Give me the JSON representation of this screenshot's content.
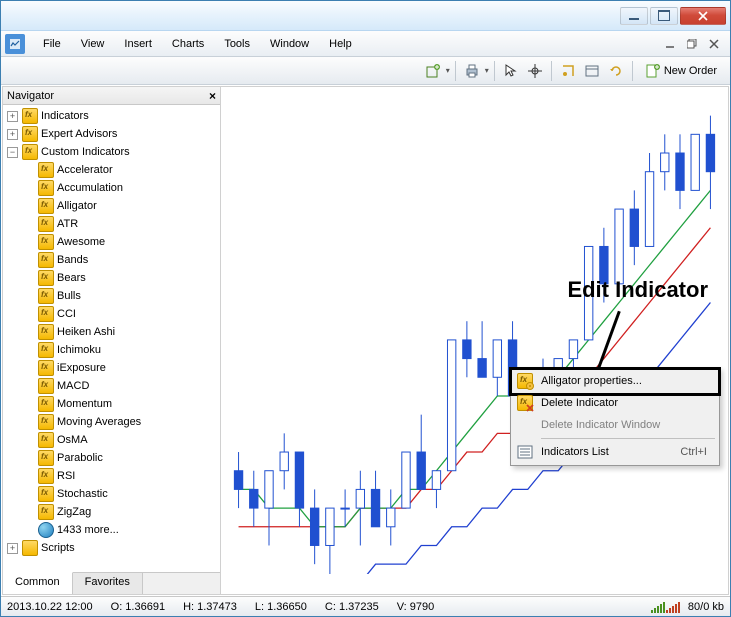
{
  "menu": {
    "items": [
      "File",
      "View",
      "Insert",
      "Charts",
      "Tools",
      "Window",
      "Help"
    ]
  },
  "toolbar": {
    "new_order": "New Order"
  },
  "navigator": {
    "title": "Navigator",
    "nodes": {
      "indicators": "Indicators",
      "expert_advisors": "Expert Advisors",
      "custom_indicators": "Custom Indicators",
      "scripts": "Scripts"
    },
    "custom_items": [
      "Accelerator",
      "Accumulation",
      "Alligator",
      "ATR",
      "Awesome",
      "Bands",
      "Bears",
      "Bulls",
      "CCI",
      "Heiken Ashi",
      "Ichimoku",
      "iExposure",
      "MACD",
      "Momentum",
      "Moving Averages",
      "OsMA",
      "Parabolic",
      "RSI",
      "Stochastic",
      "ZigZag"
    ],
    "more_link": "1433 more...",
    "tabs": {
      "common": "Common",
      "favorites": "Favorites"
    }
  },
  "context_menu": {
    "properties": "Alligator properties...",
    "delete_indicator": "Delete Indicator",
    "delete_window": "Delete Indicator Window",
    "indicators_list": "Indicators List",
    "shortcut_list": "Ctrl+I"
  },
  "annotation": {
    "label": "Edit Indicator"
  },
  "status": {
    "datetime": "2013.10.22 12:00",
    "open": "O: 1.36691",
    "high": "H: 1.37473",
    "low": "L: 1.36650",
    "close": "C: 1.37235",
    "volume": "V: 9790",
    "network": "80/0 kb"
  },
  "chart_data": {
    "type": "candlestick",
    "note": "Approximate OHLC and indicator values estimated from chart pixels",
    "price_range": [
      1.355,
      1.38
    ],
    "candles": [
      {
        "o": 1.36,
        "h": 1.361,
        "l": 1.358,
        "c": 1.359
      },
      {
        "o": 1.359,
        "h": 1.36,
        "l": 1.357,
        "c": 1.358
      },
      {
        "o": 1.358,
        "h": 1.36,
        "l": 1.356,
        "c": 1.36
      },
      {
        "o": 1.36,
        "h": 1.362,
        "l": 1.359,
        "c": 1.361
      },
      {
        "o": 1.361,
        "h": 1.361,
        "l": 1.357,
        "c": 1.358
      },
      {
        "o": 1.358,
        "h": 1.359,
        "l": 1.355,
        "c": 1.356
      },
      {
        "o": 1.356,
        "h": 1.358,
        "l": 1.354,
        "c": 1.358
      },
      {
        "o": 1.358,
        "h": 1.359,
        "l": 1.357,
        "c": 1.358
      },
      {
        "o": 1.358,
        "h": 1.36,
        "l": 1.356,
        "c": 1.359
      },
      {
        "o": 1.359,
        "h": 1.36,
        "l": 1.357,
        "c": 1.357
      },
      {
        "o": 1.357,
        "h": 1.359,
        "l": 1.356,
        "c": 1.358
      },
      {
        "o": 1.358,
        "h": 1.361,
        "l": 1.358,
        "c": 1.361
      },
      {
        "o": 1.361,
        "h": 1.363,
        "l": 1.359,
        "c": 1.359
      },
      {
        "o": 1.359,
        "h": 1.36,
        "l": 1.358,
        "c": 1.36
      },
      {
        "o": 1.36,
        "h": 1.367,
        "l": 1.36,
        "c": 1.367
      },
      {
        "o": 1.367,
        "h": 1.368,
        "l": 1.365,
        "c": 1.366
      },
      {
        "o": 1.366,
        "h": 1.368,
        "l": 1.365,
        "c": 1.365
      },
      {
        "o": 1.365,
        "h": 1.367,
        "l": 1.364,
        "c": 1.367
      },
      {
        "o": 1.367,
        "h": 1.368,
        "l": 1.364,
        "c": 1.364
      },
      {
        "o": 1.364,
        "h": 1.365,
        "l": 1.363,
        "c": 1.364
      },
      {
        "o": 1.364,
        "h": 1.366,
        "l": 1.363,
        "c": 1.365
      },
      {
        "o": 1.365,
        "h": 1.366,
        "l": 1.364,
        "c": 1.366
      },
      {
        "o": 1.366,
        "h": 1.367,
        "l": 1.365,
        "c": 1.367
      },
      {
        "o": 1.367,
        "h": 1.372,
        "l": 1.367,
        "c": 1.372
      },
      {
        "o": 1.372,
        "h": 1.373,
        "l": 1.369,
        "c": 1.37
      },
      {
        "o": 1.37,
        "h": 1.374,
        "l": 1.37,
        "c": 1.374
      },
      {
        "o": 1.374,
        "h": 1.375,
        "l": 1.371,
        "c": 1.372
      },
      {
        "o": 1.372,
        "h": 1.377,
        "l": 1.372,
        "c": 1.376
      },
      {
        "o": 1.376,
        "h": 1.378,
        "l": 1.375,
        "c": 1.377
      },
      {
        "o": 1.377,
        "h": 1.378,
        "l": 1.374,
        "c": 1.375
      },
      {
        "o": 1.375,
        "h": 1.378,
        "l": 1.375,
        "c": 1.378
      },
      {
        "o": 1.378,
        "h": 1.379,
        "l": 1.374,
        "c": 1.376
      }
    ],
    "indicators": {
      "alligator": {
        "jaw_blue": [
          1.352,
          1.352,
          1.352,
          1.353,
          1.353,
          1.353,
          1.354,
          1.354,
          1.354,
          1.355,
          1.355,
          1.355,
          1.356,
          1.356,
          1.357,
          1.357,
          1.358,
          1.358,
          1.359,
          1.359,
          1.36,
          1.36,
          1.361,
          1.362,
          1.362,
          1.363,
          1.364,
          1.365,
          1.366,
          1.367,
          1.368,
          1.369
        ],
        "teeth_red": [
          1.357,
          1.357,
          1.357,
          1.357,
          1.357,
          1.357,
          1.357,
          1.357,
          1.358,
          1.358,
          1.358,
          1.358,
          1.359,
          1.359,
          1.36,
          1.361,
          1.361,
          1.362,
          1.362,
          1.363,
          1.363,
          1.364,
          1.365,
          1.365,
          1.366,
          1.367,
          1.368,
          1.369,
          1.37,
          1.371,
          1.372,
          1.373
        ],
        "lips_green": [
          1.359,
          1.359,
          1.358,
          1.358,
          1.358,
          1.357,
          1.357,
          1.357,
          1.358,
          1.358,
          1.358,
          1.359,
          1.359,
          1.36,
          1.361,
          1.362,
          1.363,
          1.364,
          1.364,
          1.365,
          1.365,
          1.365,
          1.366,
          1.367,
          1.368,
          1.369,
          1.37,
          1.371,
          1.372,
          1.373,
          1.374,
          1.375
        ]
      }
    }
  }
}
